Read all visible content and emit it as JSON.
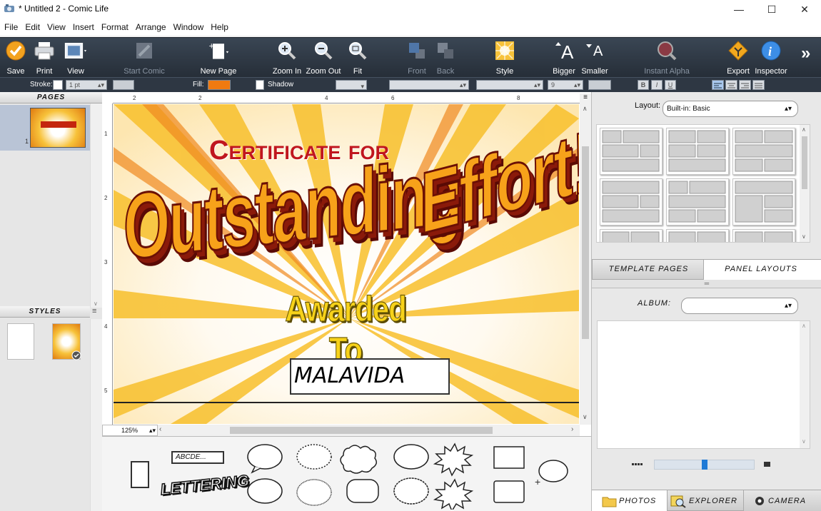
{
  "window": {
    "title": "* Untitled 2 - Comic Life",
    "minimize": "—",
    "maximize": "☐",
    "close": "✕"
  },
  "menu": [
    "File",
    "Edit",
    "View",
    "Insert",
    "Format",
    "Arrange",
    "Window",
    "Help"
  ],
  "toolbar": {
    "save": "Save",
    "print": "Print",
    "view": "View",
    "start_comic": "Start Comic",
    "new_page": "New Page",
    "zoom_in": "Zoom In",
    "zoom_out": "Zoom Out",
    "fit": "Fit",
    "front": "Front",
    "back": "Back",
    "style": "Style",
    "bigger": "Bigger",
    "smaller": "Smaller",
    "instant_alpha": "Instant Alpha",
    "export": "Export",
    "inspector": "Inspector",
    "more": "»"
  },
  "format_bar": {
    "stroke_label": "Stroke:",
    "stroke_width": "1 pt",
    "fill_label": "Fill:",
    "shadow_label": "Shadow",
    "font_size": "9",
    "bold": "B",
    "italic": "I",
    "underline": "U",
    "fill_color": "#f07a10"
  },
  "left_panel": {
    "pages_header": "PAGES",
    "page_number": "1",
    "styles_header": "STYLES"
  },
  "ruler": {
    "h": [
      "2",
      "",
      "2",
      "4",
      "6",
      "8"
    ],
    "v": [
      "1",
      "2",
      "3",
      "4",
      "5"
    ]
  },
  "page": {
    "line1": "Certificate for",
    "line2": "Outstanding",
    "line3": "Effort!",
    "awarded": "Awarded To",
    "name": "MALAVIDA"
  },
  "zoom": "125%",
  "palette": {
    "caption_text": "ABCDE...",
    "lettering_text": "LETTERING"
  },
  "right_panel": {
    "layout_label": "Layout:",
    "layout_value": "Built-in: Basic",
    "tab_templates": "TEMPLATE PAGES",
    "tab_panels": "PANEL LAYOUTS",
    "album_label": "ALBUM:",
    "album_value": "",
    "tab_photos": "PHOTOS",
    "tab_explorer": "EXPLORER",
    "tab_camera": "CAMERA",
    "slider_value": 0.5
  }
}
